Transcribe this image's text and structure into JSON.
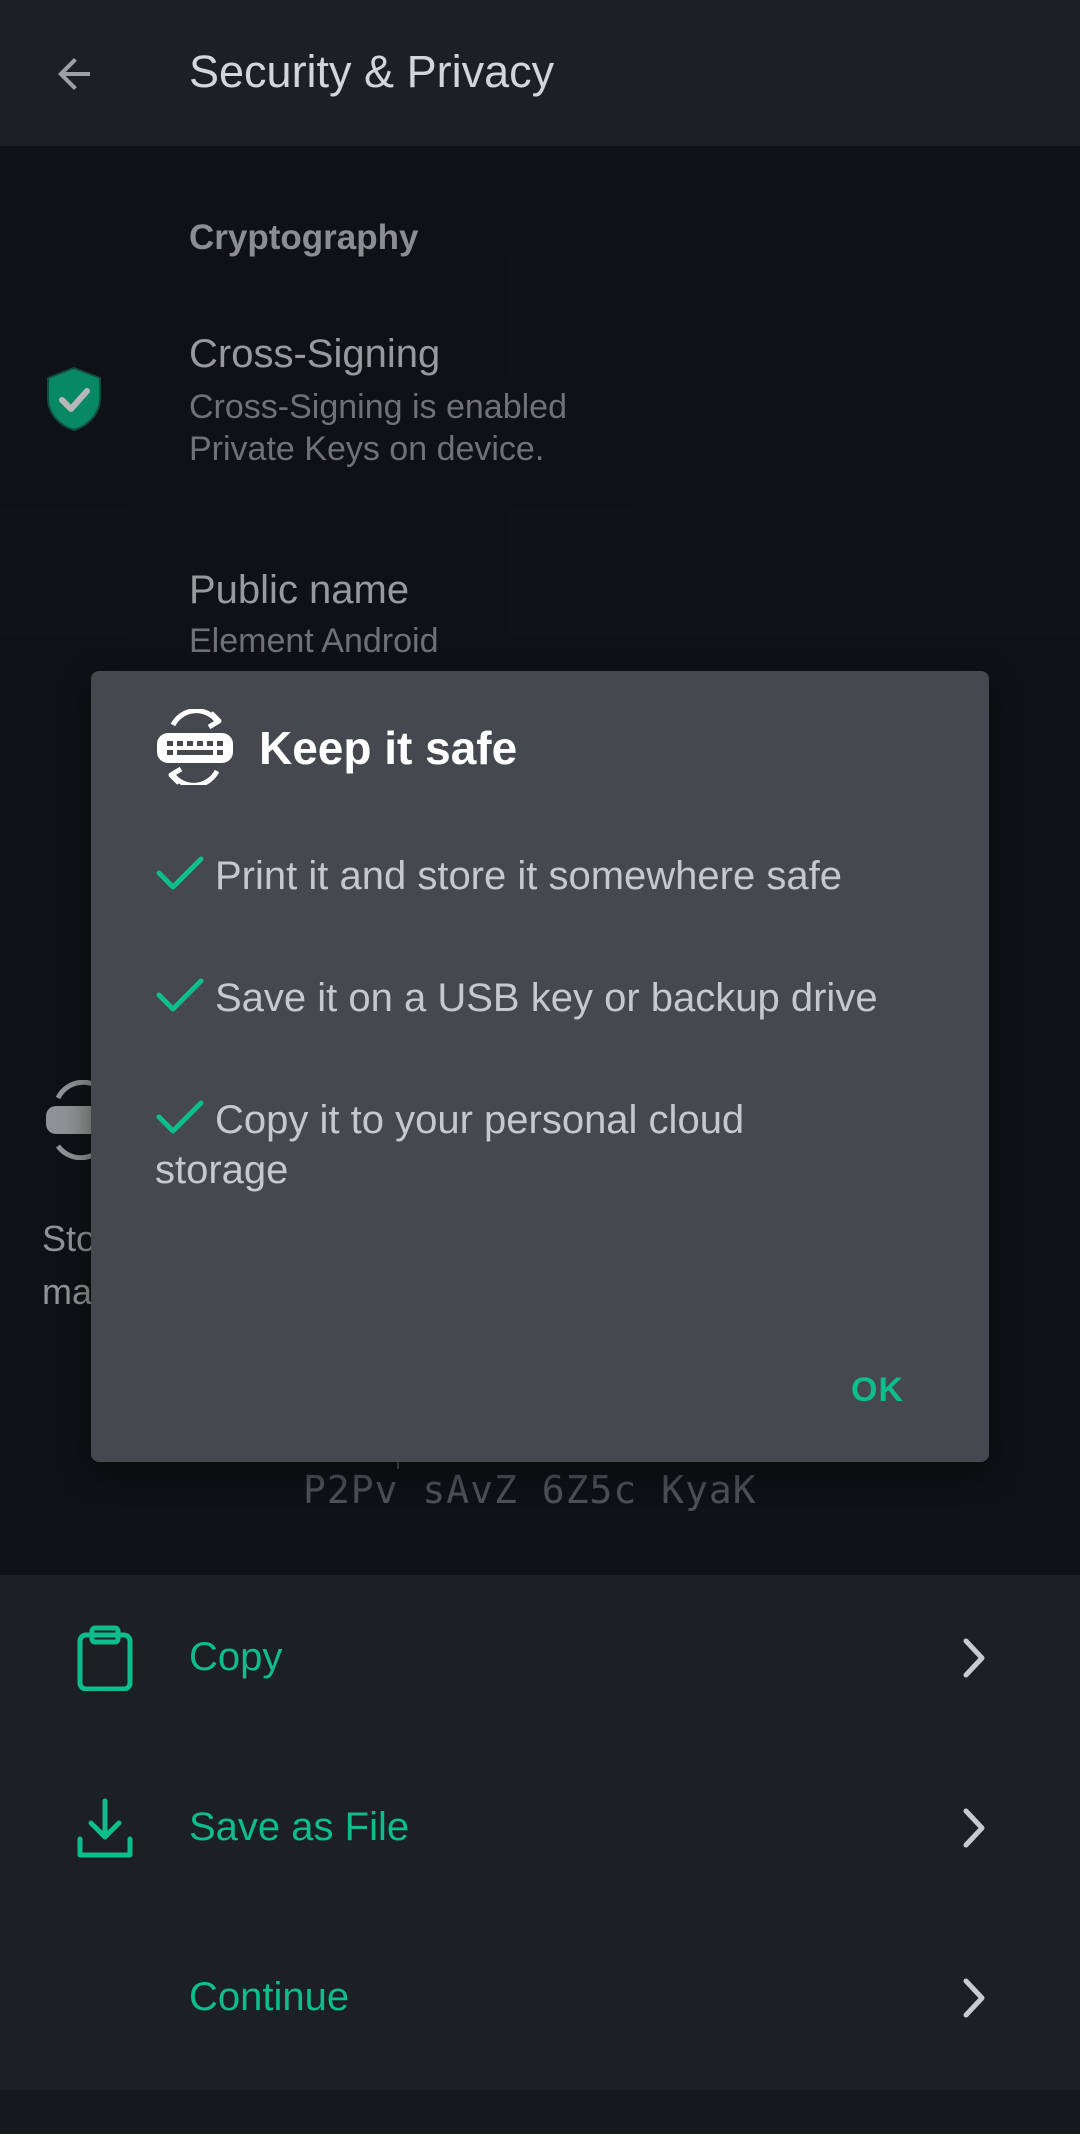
{
  "appbar": {
    "title": "Security & Privacy"
  },
  "cryptography": {
    "header": "Cryptography",
    "cross_signing": {
      "title": "Cross-Signing",
      "status": "Cross-Signing is enabled",
      "detail": "Private Keys on device."
    },
    "public_name": {
      "title": "Public name",
      "value": "Element Android"
    }
  },
  "background": {
    "description_partial": "Sto\nma",
    "recovery_key_line": "P2Pv sAvZ 6Z5c KyaK"
  },
  "actions": [
    {
      "label": "Copy",
      "icon": "clipboard-icon"
    },
    {
      "label": "Save as File",
      "icon": "download-icon"
    },
    {
      "label": "Continue",
      "icon": ""
    }
  ],
  "dialog": {
    "title": "Keep it safe",
    "icon": "key-sync-icon",
    "items": [
      "Print it and store it somewhere safe",
      "Save it on a USB key or backup drive",
      "Copy it to your personal cloud storage"
    ],
    "ok_label": "OK"
  },
  "colors": {
    "accent": "#0dbd8b",
    "background": "#15191e",
    "surface": "#1c2025",
    "dialog": "#45484e"
  }
}
